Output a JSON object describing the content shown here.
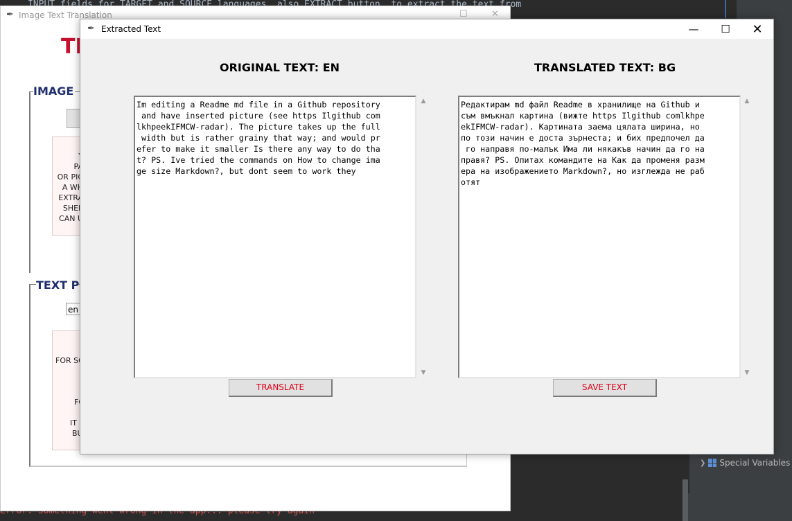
{
  "ide": {
    "code_line": "INPUT fields for TARGET and SOURCE languages, also EXTRACT button, to extract the text from",
    "special_variables": "Special Variables",
    "console_line": "Error: Something went wrong in the app... please try again"
  },
  "background_window": {
    "title": "Image Text Translation",
    "heading_partial": "TI",
    "image_frame_label_partial": "IMAGE",
    "image_info_lines": [
      "Y",
      "PA",
      "OR PIC",
      "A WH",
      "EXTRA",
      "SHEE",
      "CAN U"
    ],
    "text_frame_label_partial": "TEXT P",
    "lang_entry_value": "en",
    "text_info_lines": [
      "FOR SO",
      "FO",
      "IT I",
      "BU"
    ]
  },
  "extracted_window": {
    "title": "Extracted Text",
    "original": {
      "title": "ORIGINAL TEXT: EN",
      "lines": [
        "Im editing a Readme md file in a Github repository",
        " and have inserted picture (see https Ilgithub com",
        "lkhpeekIFMCW-radar). The picture takes up the full",
        " width but is rather grainy that way; and would pr",
        "efer to make it smaller Is there any way to do tha",
        "t? PS. Ive tried the commands on How to change ima",
        "ge size Markdown?, but dont seem to work they"
      ],
      "button_label": "TRANSLATE"
    },
    "translated": {
      "title": "TRANSLATED TEXT: BG",
      "lines": [
        "Редактирам md файл Readme в хранилище на Github и",
        "съм вмъкнал картина (вижте https Ilgithub comlkhpe",
        "ekIFMCW-radar). Картината заема цялата ширина, но",
        "по този начин е доста зърнеста; и бих предпочел да",
        " го направя по-малък Има ли някакъв начин да го на",
        "правя? PS. Опитах командите на Как да променя разм",
        "ера на изображението Markdown?, но изглежда не раб",
        "отят"
      ],
      "button_label": "SAVE TEXT"
    },
    "controls": {
      "minimize": "—",
      "maximize": "☐",
      "close": "✕"
    }
  },
  "colors": {
    "accent_red": "#e0001a",
    "heading_red": "#c8102e",
    "frame_label_blue": "#1f2e6e"
  }
}
